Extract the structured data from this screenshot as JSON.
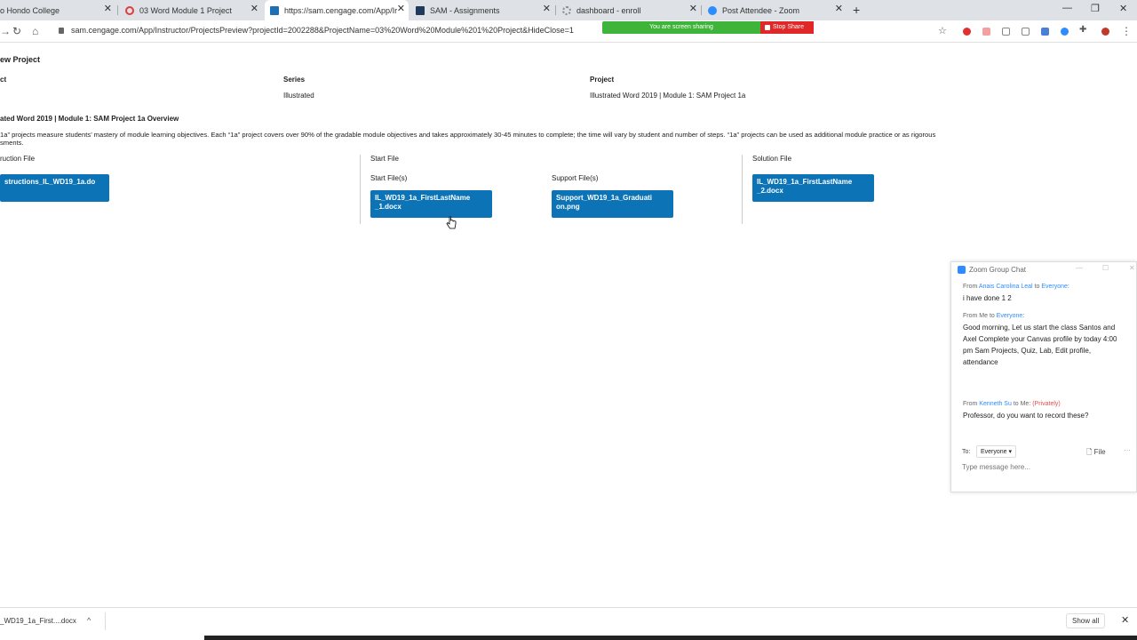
{
  "browser": {
    "tabs": [
      {
        "label": "o Hondo College",
        "icon": "document-icon",
        "color": "#777777"
      },
      {
        "label": "03 Word Module 1 Project",
        "icon": "canvas-icon",
        "color": "#e23c3c"
      },
      {
        "label": "https://sam.cengage.com/App/Ir",
        "icon": "sam-icon",
        "color": "#1f6fb5"
      },
      {
        "label": "SAM - Assignments",
        "icon": "sam-icon",
        "color": "#1f3a5c"
      },
      {
        "label": "dashboard - enroll",
        "icon": "loading-icon",
        "color": "#888888"
      },
      {
        "label": "Post Attendee - Zoom",
        "icon": "zoom-icon",
        "color": "#2d8cff"
      }
    ],
    "url": "sam.cengage.com/App/Instructor/ProjectsPreview?projectId=2002288&ProjectName=03%20Word%20Module%201%20Project&HideClose=1"
  },
  "page": {
    "title": "ew Project",
    "col1_label": "ct",
    "series_label": "Series",
    "series_value": "Illustrated",
    "project_label": "Project",
    "project_value": "Illustrated Word 2019 | Module 1: SAM Project 1a",
    "overview_title": "ated Word 2019 | Module 1: SAM Project 1a Overview",
    "overview_line1": "1a” projects measure students’ mastery of module learning objectives. Each “1a” project covers over 90% of the gradable module objectives and takes approximately 30-45 minutes to complete; the time will vary by student and number of steps. “1a” projects can be used as additional module practice or as rigorous",
    "overview_line2": "sments.",
    "instruction_file_label": "ruction File",
    "instruction_btn_line1": "structions_IL_WD19_1a.do",
    "instruction_btn_line2": "",
    "start_file_label": "Start File",
    "start_files_label": "Start File(s)",
    "start_btn_line1": "IL_WD19_1a_FirstLastName",
    "start_btn_line2": "_1.docx",
    "support_files_label": "Support File(s)",
    "support_btn_line1": "Support_WD19_1a_Graduati",
    "support_btn_line2": "on.png",
    "solution_file_label": "Solution File",
    "solution_btn_line1": "IL_WD19_1a_FirstLastName",
    "solution_btn_line2": "_2.docx"
  },
  "screenshare": {
    "status": "You are screen sharing",
    "stop_label": "Stop Share"
  },
  "chat": {
    "title": "Zoom Group Chat",
    "messages": [
      {
        "from_prefix": "From ",
        "from_name": "Anais Carolina Leal",
        "to_text": " to ",
        "to_name": "Everyone",
        "suffix": ":",
        "text": "i have done 1 2"
      },
      {
        "from_prefix": "From Me to ",
        "from_name": "",
        "to_text": "",
        "to_name": "Everyone",
        "suffix": ":",
        "text": "Good morning,  Let us start the class Santos and Axel Complete your Canvas profile by today 4:00 pm Sam Projects,  Quiz, Lab, Edit profile, attendance"
      },
      {
        "from_prefix": "From ",
        "from_name": "Kenneth Su",
        "to_text": " to Me: ",
        "to_name": "(Privately)",
        "suffix": "",
        "text": "Professor, do you want to record these?"
      }
    ],
    "to_label": "To:",
    "to_value": "Everyone",
    "file_label": "File",
    "more_label": "···",
    "input_placeholder": "Type message here..."
  },
  "downloads": {
    "item": "_WD19_1a_First....docx",
    "show_all": "Show all"
  }
}
